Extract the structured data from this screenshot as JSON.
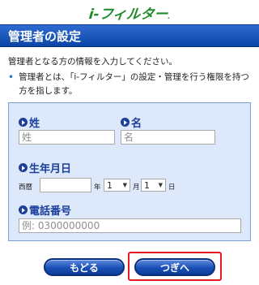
{
  "header": {
    "logo_text": "i-フィルター",
    "logo_mark": "."
  },
  "page_title": "管理者の設定",
  "intro": {
    "line1": "管理者となる方の情報を入力してください。",
    "note": "管理者とは、「i-フィルター」の設定・管理を行う権限を持つ方を指します。"
  },
  "form": {
    "last_name": {
      "label": "姓",
      "placeholder": "姓",
      "value": ""
    },
    "first_name": {
      "label": "名",
      "placeholder": "名",
      "value": ""
    },
    "birthday": {
      "label": "生年月日",
      "era_label": "西暦",
      "year_value": "",
      "year_suffix": "年",
      "month_value": "1",
      "month_suffix": "月",
      "day_value": "1",
      "day_suffix": "日"
    },
    "phone": {
      "label": "電話番号",
      "placeholder": "例: 0300000000",
      "value": ""
    }
  },
  "buttons": {
    "back": "もどる",
    "next": "つぎへ"
  },
  "colors": {
    "title_bar": "#0c45a8",
    "panel_bg": "#dde8fa",
    "label_blue": "#1b3f9a",
    "logo_green": "#1f8a2a",
    "highlight": "#e31b23"
  },
  "icons": {
    "label_marker": "arrow-circle-icon",
    "select_caret": "caret-down-icon"
  }
}
